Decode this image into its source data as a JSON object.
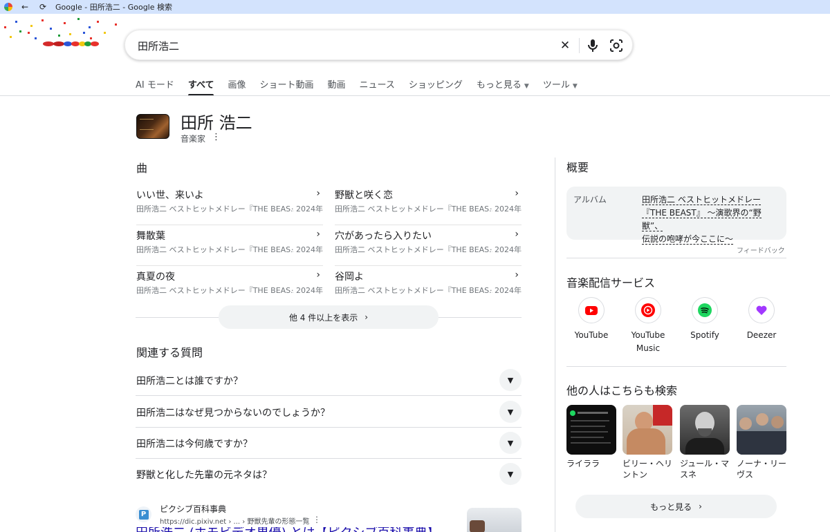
{
  "browser": {
    "tab_title": "Google - 田所浩二 - Google 検索"
  },
  "search": {
    "query": "田所浩二"
  },
  "tabs": [
    {
      "label": "AI モード"
    },
    {
      "label": "すべて"
    },
    {
      "label": "画像"
    },
    {
      "label": "ショート動画"
    },
    {
      "label": "動画"
    },
    {
      "label": "ニュース"
    },
    {
      "label": "ショッピング"
    },
    {
      "label": "もっと見る"
    },
    {
      "label": "ツール"
    }
  ],
  "entity": {
    "title": "田所 浩二",
    "subtitle": "音楽家"
  },
  "songs": {
    "heading": "曲",
    "items": [
      {
        "title": "いい世、来いよ",
        "album": "田所浩二 ベストヒットメドレー『THE BEAS...",
        "year": "· 2024年"
      },
      {
        "title": "野獣と咲く恋",
        "album": "田所浩二 ベストヒットメドレー『THE BEAS...",
        "year": "· 2024年"
      },
      {
        "title": "舞散葉",
        "album": "田所浩二 ベストヒットメドレー『THE BEAS...",
        "year": "· 2024年"
      },
      {
        "title": "穴があったら入りたい",
        "album": "田所浩二 ベストヒットメドレー『THE BEAS...",
        "year": "· 2024年"
      },
      {
        "title": "真夏の夜",
        "album": "田所浩二 ベストヒットメドレー『THE BEAS...",
        "year": "· 2024年"
      },
      {
        "title": "谷岡よ",
        "album": "田所浩二 ベストヒットメドレー『THE BEAS...",
        "year": "· 2024年"
      }
    ],
    "more_label": "他 4 件以上を表示"
  },
  "faq": {
    "heading": "関連する質問",
    "items": [
      "田所浩二とは誰ですか？",
      "田所浩二はなぜ見つからないのでしょうか？",
      "田所浩二は今何歳ですか？",
      "野獣と化した先輩の元ネタは？"
    ]
  },
  "result": {
    "site_name": "ピクシブ百科事典",
    "url": "https://dic.pixiv.net › ... › 野獣先輩の形態一覧",
    "title": "田所浩二 (ホモビデオ男優) とは【ピクシブ百科事典】"
  },
  "panel": {
    "overview_heading": "概要",
    "album_label": "アルバム",
    "album_lines": [
      "田所浩二 ベストヒットメドレー",
      "『THE BEAST』 〜演歌界の“野獣”、",
      "伝説の咆哮が今ここに〜"
    ],
    "feedback": "フィードバック",
    "services_heading": "音楽配信サービス",
    "services": [
      {
        "name": "YouTube",
        "icon": "youtube-icon",
        "color": "#ff0000"
      },
      {
        "name": "YouTube Music",
        "icon": "youtube-music-icon",
        "color": "#ff0000"
      },
      {
        "name": "Spotify",
        "icon": "spotify-icon",
        "color": "#1ed760"
      },
      {
        "name": "Deezer",
        "icon": "deezer-icon",
        "color": "#a238ff"
      }
    ],
    "people_heading": "他の人はこちらも検索",
    "people": [
      {
        "name": "ライララ"
      },
      {
        "name": "ビリー・ヘリントン"
      },
      {
        "name": "ジュール・マスネ"
      },
      {
        "name": "ノーナ・リーヴス"
      }
    ],
    "more_label": "もっと見る"
  }
}
